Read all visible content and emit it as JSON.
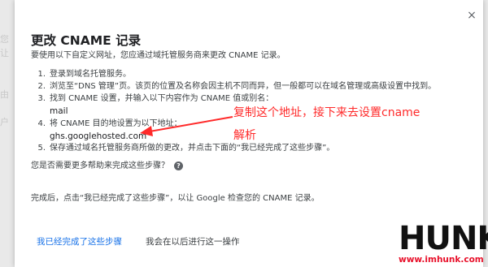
{
  "dialog": {
    "close_label": "×",
    "title": "更改 CNAME 记录",
    "subtitle": "要使用以下自定义网址，您应通过域托管服务商来更改 CNAME 记录。",
    "steps": [
      {
        "num": "1.",
        "text": "登录到域名托管服务。"
      },
      {
        "num": "2.",
        "text": "浏览至“DNS 管理”页。该页的位置及名称会因主机不同而异，但一般都可以在域名管理或高级设置中找到。"
      },
      {
        "num": "3.",
        "text": "找到 CNAME 设置，并输入以下内容作为 CNAME 值或别名："
      },
      {
        "num": "4.",
        "text": "将 CNAME 目的地设置为以下地址："
      },
      {
        "num": "5.",
        "text": "保存通过域名托管服务商所做的更改，并点击下面的“我已经完成了这些步骤”。"
      }
    ],
    "cname_value": "mail",
    "cname_target": "ghs.googlehosted.com",
    "help_text": "您是否需要更多帮助来完成这些步骤？",
    "help_icon": "?",
    "done_text": "完成后，点击“我已经完成了这些步骤”，以让 Google 检查您的 CNAME 记录。",
    "primary_button": "我已经完成了这些步骤",
    "later_button": "我会在以后进行这一操作"
  },
  "annotation": {
    "line1": "复制这个地址，接下来去设置cname",
    "line2": "解析",
    "color": "#ff2a2a"
  },
  "watermark": {
    "logo_text": "HUNK",
    "url": "www.imhunk.com"
  },
  "colors": {
    "accent": "#1a73e8",
    "annotation": "#ff2a2a",
    "logo_url": "#e8102a"
  }
}
